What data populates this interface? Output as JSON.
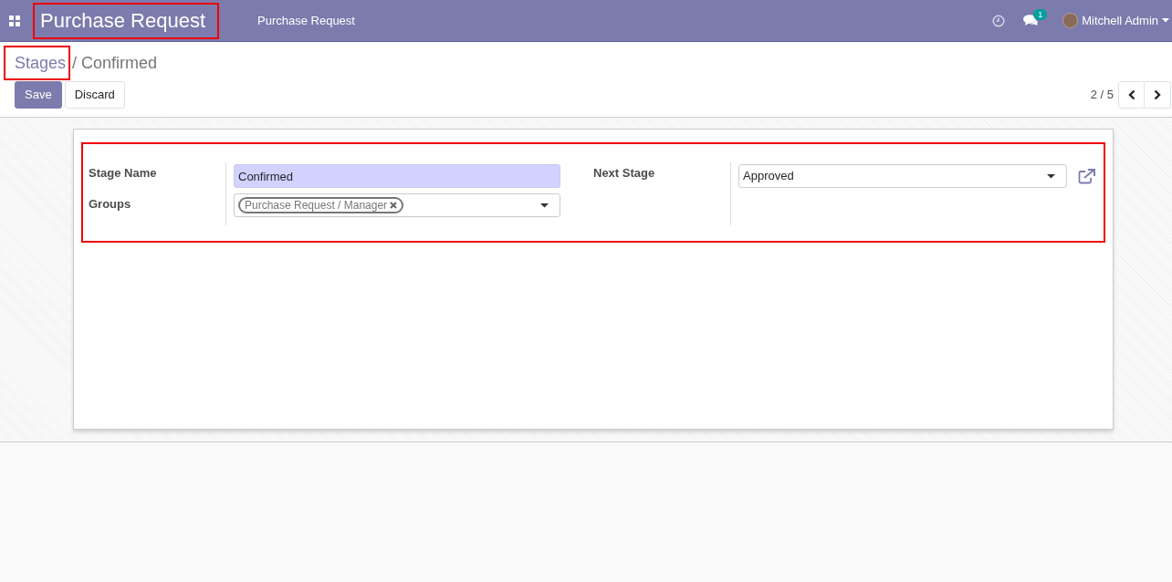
{
  "navbar": {
    "app_title": "Purchase Request",
    "menu": [
      "Purchase Request"
    ],
    "messages_badge": "1",
    "user": "Mitchell Admin"
  },
  "breadcrumb": {
    "parent": "Stages",
    "separator": "/",
    "current": "Confirmed"
  },
  "buttons": [
    "Save",
    "Discard"
  ],
  "pager": {
    "value": "2 / 5"
  },
  "form": {
    "left": [
      {
        "kind": "text",
        "label": "Stage Name",
        "value": "Confirmed",
        "required": true
      },
      {
        "kind": "tags",
        "label": "Groups",
        "tags": [
          "Purchase Request / Manager"
        ],
        "required": false
      }
    ],
    "right": [
      {
        "kind": "select",
        "label": "Next Stage",
        "value": "Approved",
        "required": false
      }
    ]
  }
}
